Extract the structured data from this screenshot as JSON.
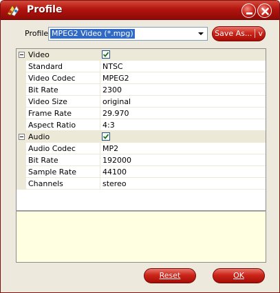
{
  "window": {
    "title": "Profile",
    "icons": {
      "app": "profile-app-icon",
      "minimize": "minimize-icon",
      "close": "close-icon"
    }
  },
  "profile": {
    "label": "Profile:",
    "selected": "MPEG2 Video (*.mpg)",
    "save_as_label": "Save As...",
    "save_as_arrow": "v"
  },
  "grid": {
    "video": {
      "label": "Video",
      "enabled": true,
      "rows": [
        {
          "name": "Standard",
          "value": "NTSC"
        },
        {
          "name": "Video Codec",
          "value": "MPEG2"
        },
        {
          "name": "Bit Rate",
          "value": "2300"
        },
        {
          "name": "Video Size",
          "value": "original"
        },
        {
          "name": "Frame Rate",
          "value": "29.970"
        },
        {
          "name": "Aspect Ratio",
          "value": "4:3"
        }
      ]
    },
    "audio": {
      "label": "Audio",
      "enabled": true,
      "rows": [
        {
          "name": "Audio Codec",
          "value": "MP2"
        },
        {
          "name": "Bit Rate",
          "value": "192000"
        },
        {
          "name": "Sample Rate",
          "value": "44100"
        },
        {
          "name": "Channels",
          "value": "stereo"
        }
      ]
    }
  },
  "buttons": {
    "reset_label": "Reset",
    "ok_label": "OK"
  },
  "colors": {
    "title_bar": "#b2150f",
    "button_red": "#cc2519",
    "selection": "#316ac5",
    "description_bg": "#ffffe1"
  }
}
